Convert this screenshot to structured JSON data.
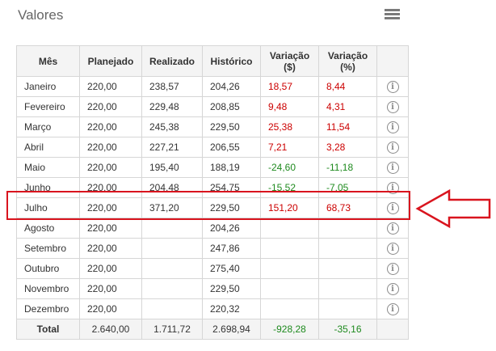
{
  "header": {
    "title": "Valores"
  },
  "table": {
    "columns": [
      "Mês",
      "Planejado",
      "Realizado",
      "Histórico",
      "Variação ($)",
      "Variação (%)",
      ""
    ],
    "rows": [
      {
        "mes": "Janeiro",
        "planejado": "220,00",
        "realizado": "238,57",
        "historico": "204,26",
        "var_abs": "18,57",
        "var_pct": "8,44",
        "tone": "red"
      },
      {
        "mes": "Fevereiro",
        "planejado": "220,00",
        "realizado": "229,48",
        "historico": "208,85",
        "var_abs": "9,48",
        "var_pct": "4,31",
        "tone": "red"
      },
      {
        "mes": "Março",
        "planejado": "220,00",
        "realizado": "245,38",
        "historico": "229,50",
        "var_abs": "25,38",
        "var_pct": "11,54",
        "tone": "red"
      },
      {
        "mes": "Abril",
        "planejado": "220,00",
        "realizado": "227,21",
        "historico": "206,55",
        "var_abs": "7,21",
        "var_pct": "3,28",
        "tone": "red"
      },
      {
        "mes": "Maio",
        "planejado": "220,00",
        "realizado": "195,40",
        "historico": "188,19",
        "var_abs": "-24,60",
        "var_pct": "-11,18",
        "tone": "green"
      },
      {
        "mes": "Junho",
        "planejado": "220,00",
        "realizado": "204,48",
        "historico": "254,75",
        "var_abs": "-15,52",
        "var_pct": "-7,05",
        "tone": "green"
      },
      {
        "mes": "Julho",
        "planejado": "220,00",
        "realizado": "371,20",
        "historico": "229,50",
        "var_abs": "151,20",
        "var_pct": "68,73",
        "tone": "red"
      },
      {
        "mes": "Agosto",
        "planejado": "220,00",
        "realizado": "",
        "historico": "204,26",
        "var_abs": "",
        "var_pct": "",
        "tone": ""
      },
      {
        "mes": "Setembro",
        "planejado": "220,00",
        "realizado": "",
        "historico": "247,86",
        "var_abs": "",
        "var_pct": "",
        "tone": ""
      },
      {
        "mes": "Outubro",
        "planejado": "220,00",
        "realizado": "",
        "historico": "275,40",
        "var_abs": "",
        "var_pct": "",
        "tone": ""
      },
      {
        "mes": "Novembro",
        "planejado": "220,00",
        "realizado": "",
        "historico": "229,50",
        "var_abs": "",
        "var_pct": "",
        "tone": ""
      },
      {
        "mes": "Dezembro",
        "planejado": "220,00",
        "realizado": "",
        "historico": "220,32",
        "var_abs": "",
        "var_pct": "",
        "tone": ""
      }
    ],
    "total": {
      "label": "Total",
      "planejado": "2.640,00",
      "realizado": "1.711,72",
      "historico": "2.698,94",
      "var_abs": "-928,28",
      "var_pct": "-35,16"
    },
    "highlighted_row": "Julho"
  },
  "icons": {
    "menu": "hamburger-menu-icon",
    "row_info": "info-circle-icon",
    "annotation_arrow": "left-arrow-icon"
  },
  "colors": {
    "positive_variance": "#cc0000",
    "negative_variance": "#1e8a1e",
    "highlight": "#d9141e"
  }
}
